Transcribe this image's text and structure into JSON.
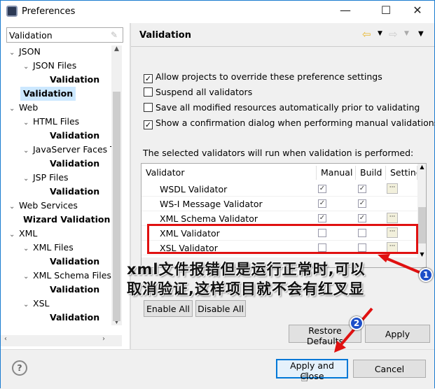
{
  "window": {
    "title": "Preferences",
    "minimize": "—",
    "maximize": "☐",
    "close": "✕"
  },
  "filter": {
    "value": "Validation"
  },
  "tree": [
    {
      "label": "JSON",
      "level": 0,
      "expanded": true,
      "bold": false
    },
    {
      "label": "JSON Files",
      "level": 1,
      "expanded": true,
      "bold": false
    },
    {
      "label": "Validation",
      "level": 2,
      "bold": true
    },
    {
      "label": "Validation",
      "level": 0,
      "bold": true,
      "selected": true
    },
    {
      "label": "Web",
      "level": 0,
      "expanded": true
    },
    {
      "label": "HTML Files",
      "level": 1,
      "expanded": true
    },
    {
      "label": "Validation",
      "level": 2,
      "bold": true
    },
    {
      "label": "JavaServer Faces T",
      "level": 1,
      "expanded": true
    },
    {
      "label": "Validation",
      "level": 2,
      "bold": true
    },
    {
      "label": "JSP Files",
      "level": 1,
      "expanded": true
    },
    {
      "label": "Validation",
      "level": 2,
      "bold": true
    },
    {
      "label": "Web Services",
      "level": 0,
      "expanded": true
    },
    {
      "label": "Wizard Validation",
      "level": 1,
      "bold": true
    },
    {
      "label": "XML",
      "level": 0,
      "expanded": true
    },
    {
      "label": "XML Files",
      "level": 1,
      "expanded": true
    },
    {
      "label": "Validation",
      "level": 2,
      "bold": true
    },
    {
      "label": "XML Schema Files",
      "level": 1,
      "expanded": true
    },
    {
      "label": "Validation",
      "level": 2,
      "bold": true
    },
    {
      "label": "XSL",
      "level": 1,
      "expanded": true
    },
    {
      "label": "Validation",
      "level": 2,
      "bold": true
    }
  ],
  "page": {
    "title": "Validation"
  },
  "options": [
    {
      "label": "Allow projects to override these preference settings",
      "checked": true
    },
    {
      "label": "Suspend all validators",
      "checked": false
    },
    {
      "label": "Save all modified resources automatically prior to validating",
      "checked": false
    },
    {
      "label": "Show a confirmation dialog when performing manual validations",
      "checked": true
    }
  ],
  "table_caption": "The selected validators will run when validation is performed:",
  "table": {
    "headers": [
      "Validator",
      "Manual",
      "Build",
      "Settings"
    ],
    "rows": [
      {
        "name": "WSDL Validator",
        "manual": true,
        "build": true,
        "settings": true
      },
      {
        "name": "WS-I Message Validator",
        "manual": true,
        "build": true,
        "settings": false
      },
      {
        "name": "XML Schema Validator",
        "manual": true,
        "build": true,
        "settings": true
      },
      {
        "name": "XML Validator",
        "manual": false,
        "build": false,
        "settings": true
      },
      {
        "name": "XSL Validator",
        "manual": false,
        "build": false,
        "settings": true
      }
    ]
  },
  "buttons": {
    "enable_all": "Enable All",
    "disable_all": "Disable All",
    "restore_defaults": "Restore Defaults",
    "apply": "Apply",
    "apply_close": "Apply and Close",
    "cancel": "Cancel",
    "help": "?"
  },
  "annotation": {
    "line1": "xml文件报错但是运行正常时,可以",
    "line2": "取消验证,这样项目就不会有红叉显",
    "badge1": "1",
    "badge2": "2",
    "color": "#e01010"
  }
}
